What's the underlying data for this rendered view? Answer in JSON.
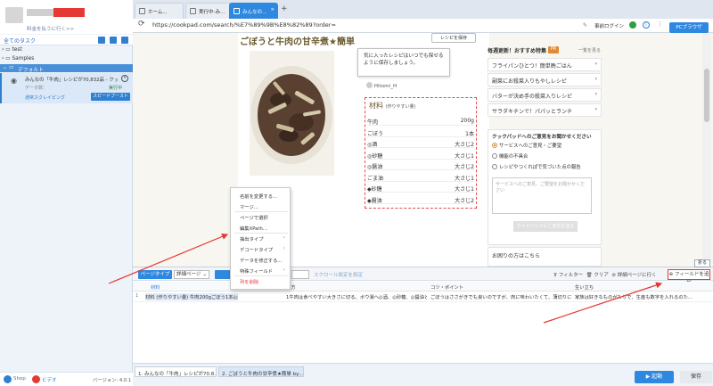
{
  "sidebar": {
    "user_sub": "料金を払うに行く>>",
    "tasks_header": "全てのタスク",
    "tree": [
      {
        "label": "test"
      },
      {
        "label": "Samples"
      },
      {
        "label": "デフォルト"
      }
    ],
    "task": {
      "title": "みんなの「牛肉」レシピが70,832品 - クッ...",
      "count_label": "データ数：",
      "mode": "通常スクレイピング",
      "status": "実行中",
      "speed_button": "スピードブースト"
    },
    "bottom": {
      "shop": "Shop",
      "video": "ビデオ",
      "version": "バージョン: 4.0.1"
    }
  },
  "browser": {
    "tabs": [
      {
        "label": "ホーム..."
      },
      {
        "label": "実行中-み..."
      },
      {
        "label": "みんなの..."
      }
    ],
    "url": "https://cookpad.com/search/%E7%89%9B%E8%82%89?order=",
    "login": "事前ログイン",
    "pc_browser": "PCブラウザ"
  },
  "recipe": {
    "title": "ごぼうと牛肉の甘辛煮★簡単",
    "save_button": "レシピを保存",
    "tooltip": "気に入ったレシピはいつでも探せるように保存しましょう。",
    "author": "Hitomi_H",
    "ingredients_title": "材料",
    "ingredients_sub": "(作りやすい量)",
    "ingredients": [
      {
        "name": "牛肉",
        "qty": "200g"
      },
      {
        "name": "ごぼう",
        "qty": "1本"
      },
      {
        "name": "◎酒",
        "qty": "大さじ2"
      },
      {
        "name": "◎砂糖",
        "qty": "大さじ1"
      },
      {
        "name": "◎醤油",
        "qty": "大さじ2"
      },
      {
        "name": "ごま油",
        "qty": "大さじ1"
      },
      {
        "name": "◆砂糖",
        "qty": "大さじ1"
      },
      {
        "name": "◆醤油",
        "qty": "大さじ2"
      }
    ]
  },
  "right_panel": {
    "header": "毎週更新！おすすめ特集",
    "badge": "PR",
    "more": "一覧を見る",
    "items": [
      "フライパンひとつ！簡単晩ごはん",
      "副菜にお殺菜入りもやしレシピ",
      "バターが決め手の殺菜入りレシピ",
      "サラダキチンで！パパッとランチ"
    ],
    "feedback_title": "クックパッドへのご意見をお聞かせください",
    "feedback_options": [
      "サービスへのご意見・ご要望",
      "機能の不具合",
      "レシピやつくれぽで気づいた点の報告"
    ],
    "feedback_placeholder": "サービスへのご意見、ご要望をお聞かせください",
    "feedback_send": "クックパッドにご意見を送る",
    "help": "お困りの方はこちら"
  },
  "context_menu": {
    "items": [
      {
        "label": "名前を変更する...",
        "arrow": false
      },
      {
        "label": "マージ...",
        "arrow": false
      },
      {
        "label": "ページで選択",
        "arrow": false
      },
      {
        "label": "編集XPath...",
        "arrow": false
      },
      {
        "label": "抽出タイプ",
        "arrow": true
      },
      {
        "label": "デコードタイプ",
        "arrow": true
      },
      {
        "label": "データを修正する...",
        "arrow": false
      },
      {
        "label": "特殊フィールド",
        "arrow": true
      },
      {
        "label": "列を削除",
        "arrow": false
      }
    ]
  },
  "data_panel": {
    "page_type_label": "ページタイプ",
    "page_type_value": "詳細ページ",
    "scroll_setting": "スクロール設定を設定",
    "filter": "フィルター",
    "clear": "クリア",
    "detail_page": "詳細ページに行く",
    "add_field": "フィールドを追加",
    "fold": "折る",
    "columns": [
      "材料",
      "り方",
      "コツ・ポイント",
      "生い立ち"
    ],
    "row": {
      "index": "1",
      "ingredients": "材料 (作りやすい量) 牛肉200gごぼう1本◎酒大さじ2◎砂糖大さ...",
      "steps": "1牛肉は食べやすい大きさに切る。ボウ湯へ◎酒、◎砂糖、◎醤油と...",
      "tips": "ごぼうはささがきでも良いのですが、肉に味わいたくて、薄切りに...",
      "origin": "家族は好きなものがたりで、生産も数字を入れるのた..."
    }
  },
  "status_bar": {
    "tabs": [
      "1. みんなの「牛肉」レシピが70.8...",
      "2. ごぼうと牛肉の甘辛煮★簡単 by..."
    ],
    "start": "起動",
    "save": "保存"
  },
  "colors": {
    "accent": "#2f88e0",
    "highlight": "#e53935",
    "recipe_brown": "#6b5a2e"
  }
}
